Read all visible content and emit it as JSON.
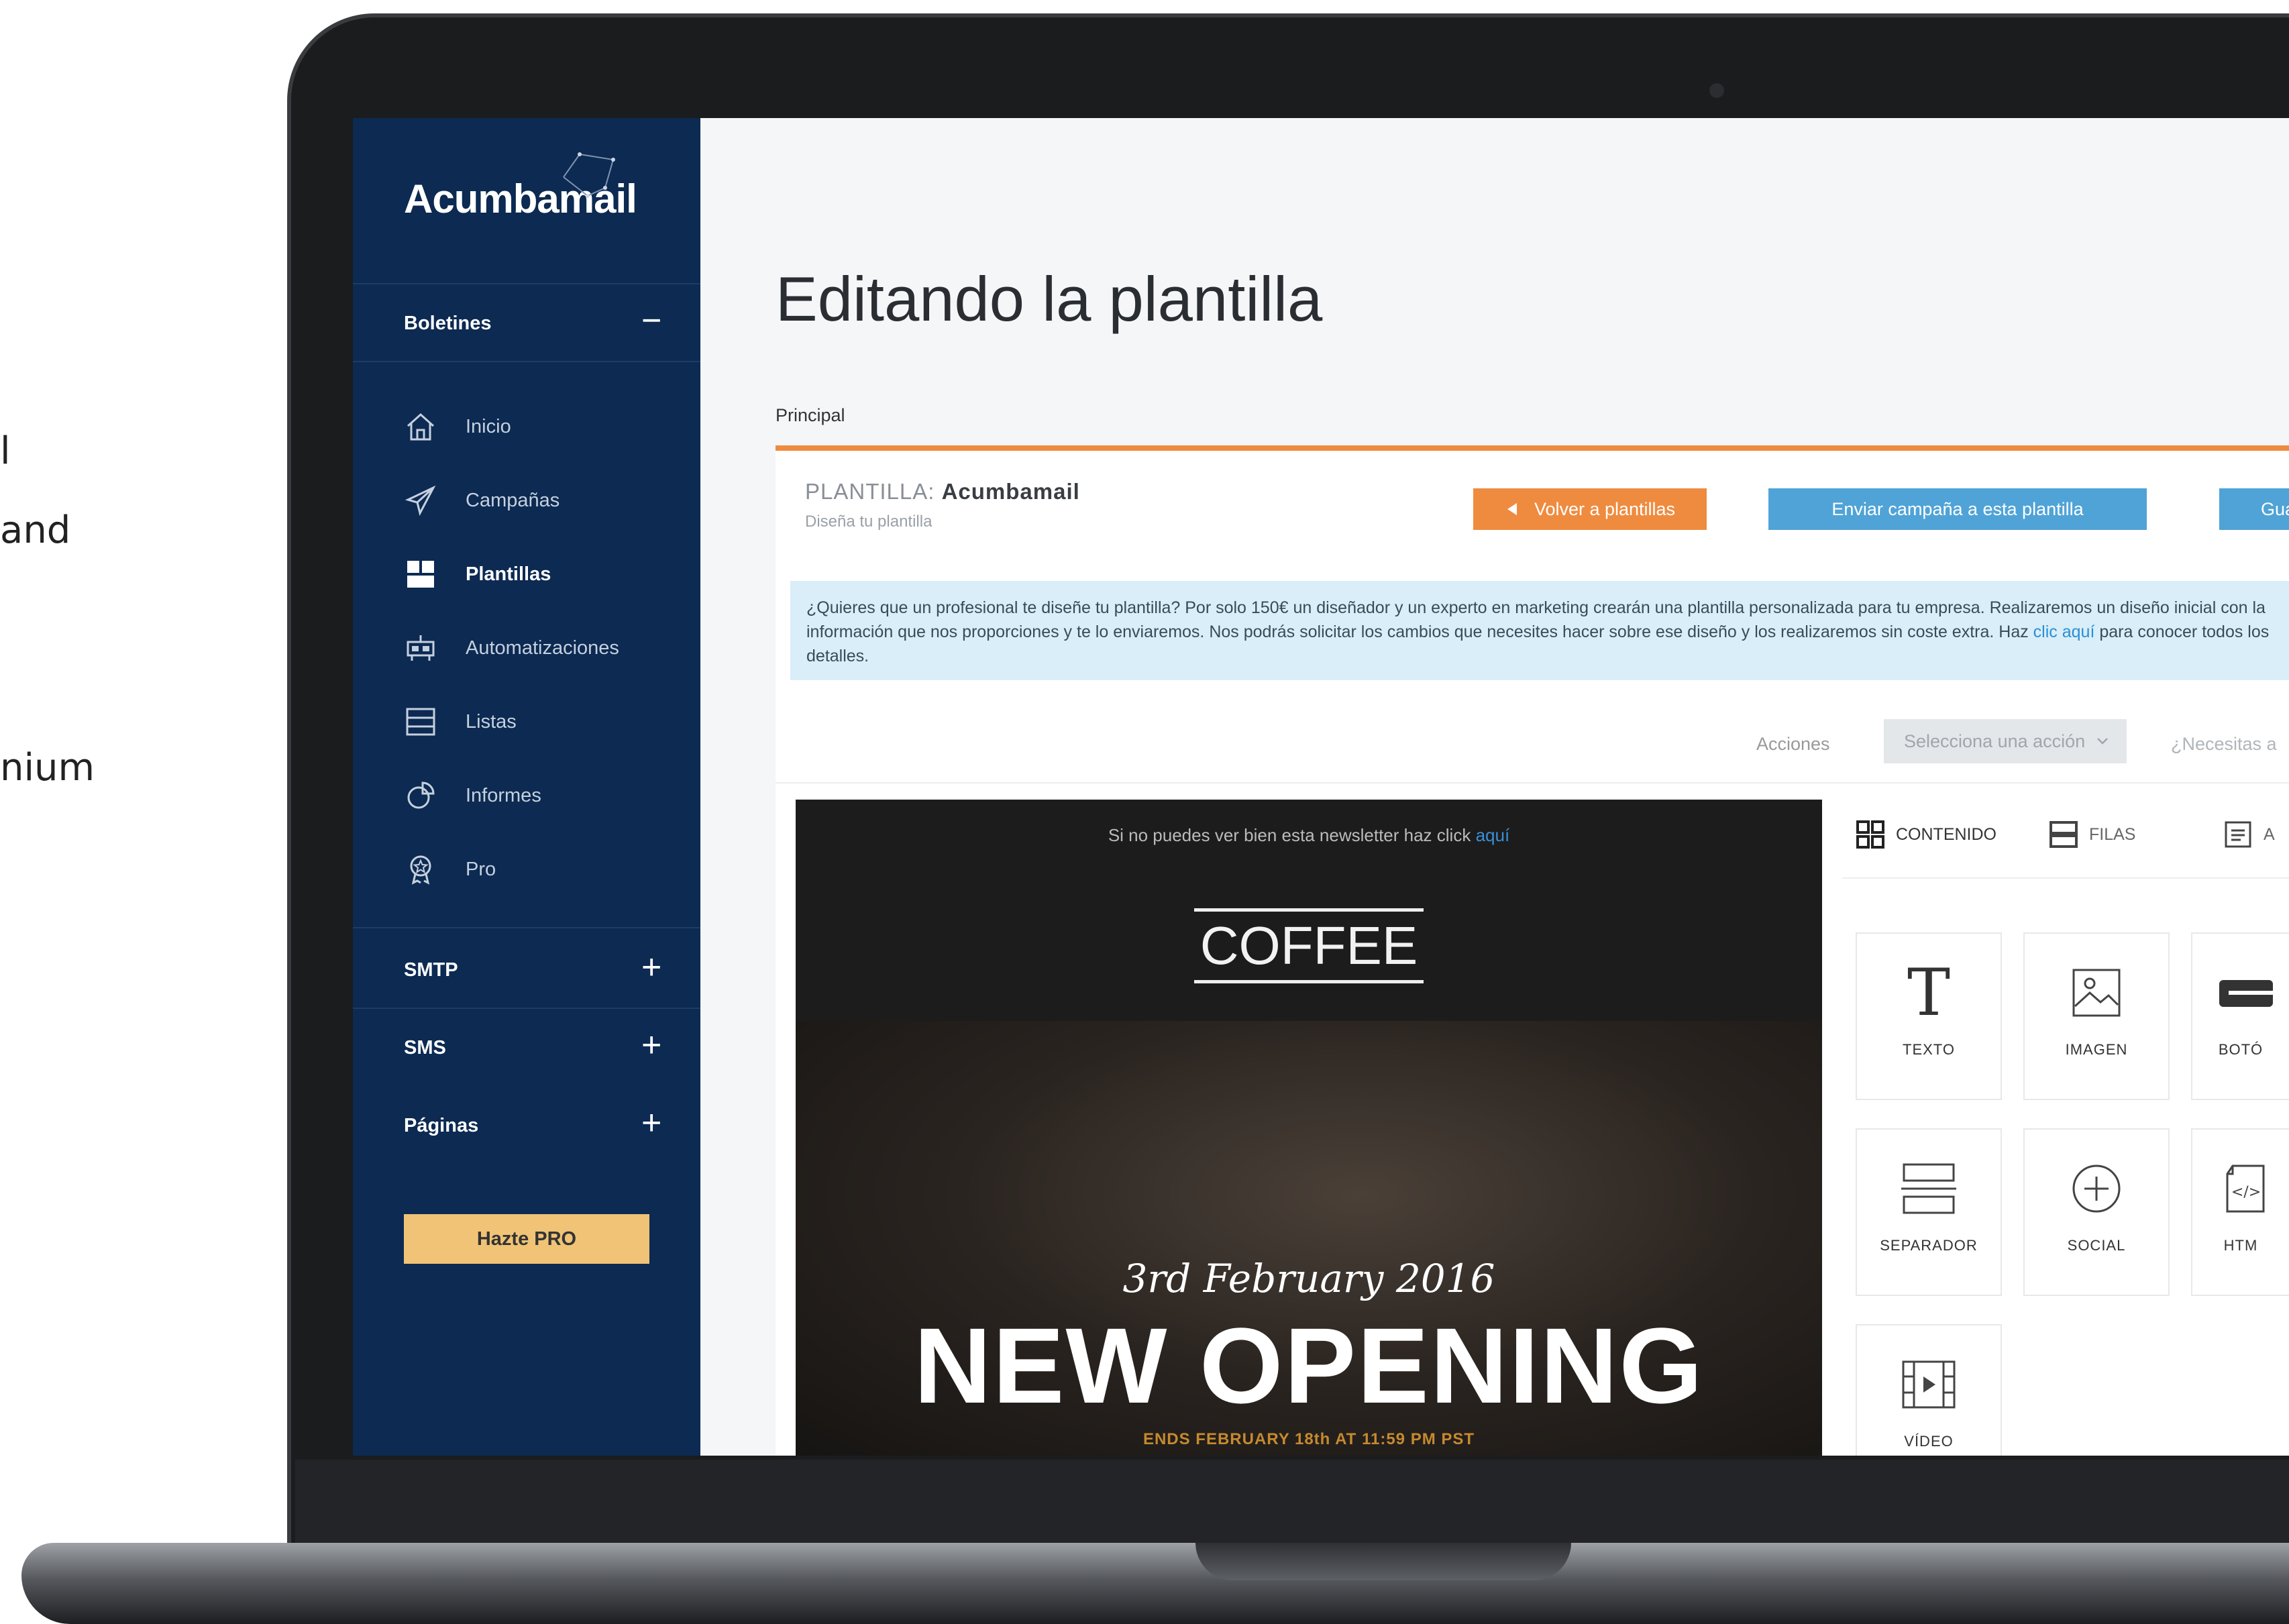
{
  "left_fragments": [
    "l",
    "and",
    "nium"
  ],
  "app": {
    "logo": "Acumbamail"
  },
  "sidebar": {
    "sections": {
      "boletines": {
        "label": "Boletines",
        "toggle": "−"
      },
      "smtp": {
        "label": "SMTP",
        "toggle": "+"
      },
      "sms": {
        "label": "SMS",
        "toggle": "+"
      },
      "paginas": {
        "label": "Páginas",
        "toggle": "+"
      }
    },
    "items": [
      {
        "label": "Inicio",
        "icon": "home-icon"
      },
      {
        "label": "Campañas",
        "icon": "paper-plane-icon"
      },
      {
        "label": "Plantillas",
        "icon": "template-icon",
        "active": true
      },
      {
        "label": "Automatizaciones",
        "icon": "automation-icon"
      },
      {
        "label": "Listas",
        "icon": "list-icon"
      },
      {
        "label": "Informes",
        "icon": "report-icon"
      },
      {
        "label": "Pro",
        "icon": "award-icon"
      }
    ],
    "pro_button": "Hazte PRO"
  },
  "main": {
    "title": "Editando la plantilla",
    "tab": "Principal",
    "template": {
      "prefix": "PLANTILLA:",
      "name": "Acumbamail",
      "subtitle": "Diseña tu plantilla"
    },
    "buttons": {
      "back": "Volver a plantillas",
      "send": "Enviar campaña a esta plantilla",
      "save": "Guard"
    },
    "info": {
      "text_before": "¿Quieres que un profesional te diseñe tu plantilla? Por solo 150€ un diseñador y un experto en marketing crearán una plantilla personalizada para tu empresa. Realizaremos un diseño inicial con la información que nos proporciones y te lo enviaremos. Nos podrás solicitar los cambios que necesites hacer sobre ese diseño y los realizaremos sin coste extra. Haz ",
      "link": "clic aquí",
      "text_after": " para conocer todos los detalles."
    },
    "actions": {
      "label": "Acciones",
      "select": "Selecciona una acción",
      "help": "¿Necesitas a"
    }
  },
  "preview": {
    "notice": "Si no puedes ver bien esta newsletter haz click ",
    "notice_link": "aquí",
    "logo_word": "COFFEE",
    "date": "3rd February 2016",
    "headline": "NEW OPENING",
    "ends": "ENDS FEBRUARY 18th AT 11:59 PM PST"
  },
  "builder": {
    "tabs": [
      "CONTENIDO",
      "FILAS",
      "A"
    ],
    "tiles": [
      {
        "label": "TEXTO",
        "icon": "text-icon"
      },
      {
        "label": "IMAGEN",
        "icon": "image-icon"
      },
      {
        "label": "BOTÓ",
        "icon": "button-icon"
      },
      {
        "label": "SEPARADOR",
        "icon": "separator-icon"
      },
      {
        "label": "SOCIAL",
        "icon": "social-icon"
      },
      {
        "label": "HTM",
        "icon": "html-icon"
      },
      {
        "label": "VÍDEO",
        "icon": "video-icon"
      }
    ]
  },
  "colors": {
    "sidebar": "#0c2a52",
    "accent_orange": "#ef8b3f",
    "accent_blue": "#4fa3d7",
    "pro_gold": "#f0c376",
    "info_bg": "#d9eef8"
  }
}
